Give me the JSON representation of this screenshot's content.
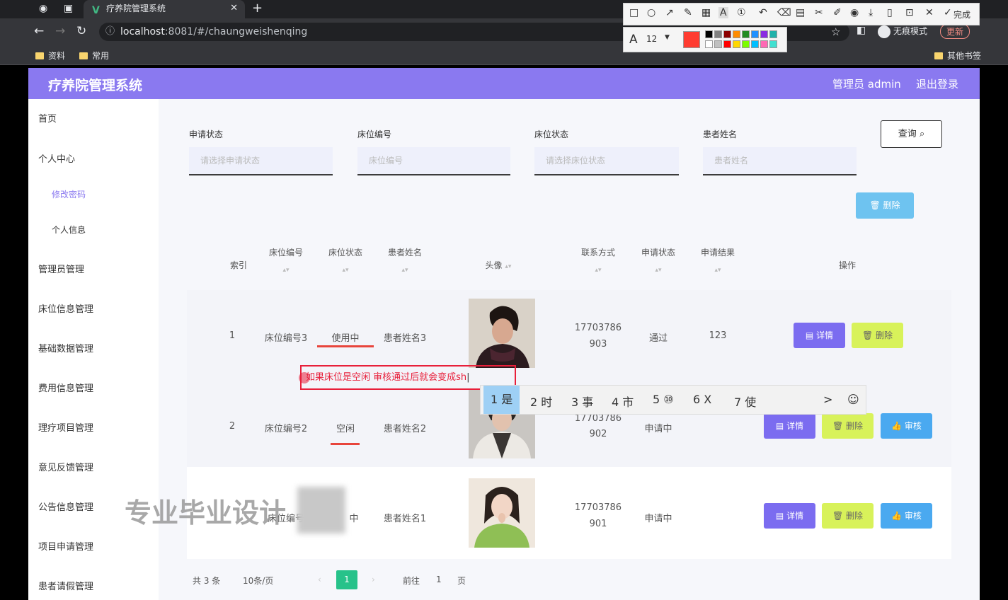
{
  "browser": {
    "tab_title": "疗养院管理系统",
    "tab_logo": "V",
    "url_host": "localhost",
    "url_rest": ":8081/#/chaungweishenqing",
    "bookmarks": [
      "资料",
      "常用"
    ],
    "other_bookmarks": "其他书签",
    "incognito_label": "无痕模式",
    "update_label": "更新"
  },
  "snap_tool": {
    "done_label": "完成",
    "font_size": "12",
    "icons": [
      "rect-icon",
      "circle-icon",
      "arrow-icon",
      "pen-icon",
      "mosaic-icon",
      "text-icon",
      "number-icon",
      "undo-icon",
      "delete-icon",
      "ocr-icon",
      "scissors-icon",
      "pin-icon",
      "record-icon",
      "download-icon",
      "save-icon",
      "pin-window-icon",
      "close-icon",
      "check-icon"
    ],
    "colors": [
      "#ff3b30",
      "#000000",
      "#808080",
      "#8b0000",
      "#ff8c00",
      "#228b22",
      "#1e90ff",
      "#8a2be2",
      "#20b2aa",
      "#ffffff",
      "#c0c0c0",
      "#ff0000",
      "#ffd700",
      "#7cfc00",
      "#00bfff",
      "#ff69b4",
      "#40e0d0"
    ]
  },
  "app": {
    "title": "疗养院管理系统",
    "admin_label": "管理员 admin",
    "logout_label": "退出登录"
  },
  "sidebar": {
    "items": [
      {
        "label": "首页"
      },
      {
        "label": "个人中心"
      },
      {
        "label": "修改密码",
        "sub": true,
        "active": true
      },
      {
        "label": "个人信息",
        "sub": true
      },
      {
        "label": "管理员管理"
      },
      {
        "label": "床位信息管理"
      },
      {
        "label": "基础数据管理"
      },
      {
        "label": "费用信息管理"
      },
      {
        "label": "理疗项目管理"
      },
      {
        "label": "意见反馈管理"
      },
      {
        "label": "公告信息管理"
      },
      {
        "label": "项目申请管理"
      },
      {
        "label": "患者请假管理"
      }
    ]
  },
  "search": {
    "fields": [
      {
        "label": "申请状态",
        "placeholder": "请选择申请状态"
      },
      {
        "label": "床位编号",
        "placeholder": "床位编号"
      },
      {
        "label": "床位状态",
        "placeholder": "请选择床位状态"
      },
      {
        "label": "患者姓名",
        "placeholder": "患者姓名"
      }
    ],
    "query_label": "查询",
    "delete_label": "删除"
  },
  "table": {
    "headers": [
      "索引",
      "床位编号",
      "床位状态",
      "患者姓名",
      "头像",
      "联系方式",
      "申请状态",
      "申请结果",
      "操作"
    ],
    "rows": [
      {
        "index": "1",
        "bed_no": "床位编号3",
        "bed_status": "使用中",
        "patient": "患者姓名3",
        "phone1": "17703786",
        "phone2": "903",
        "apply_status": "通过",
        "result": "123",
        "actions": [
          "详情",
          "删除"
        ]
      },
      {
        "index": "2",
        "bed_no": "床位编号2",
        "bed_status": "空闲",
        "patient": "患者姓名2",
        "phone1": "17703786",
        "phone2": "902",
        "apply_status": "申请中",
        "result": "",
        "actions": [
          "详情",
          "删除",
          "审核"
        ]
      },
      {
        "index": "",
        "bed_no": "床位编号",
        "bed_status": "中",
        "patient": "患者姓名1",
        "phone1": "17703786",
        "phone2": "901",
        "apply_status": "申请中",
        "result": "",
        "actions": [
          "详情",
          "删除",
          "审核"
        ]
      }
    ]
  },
  "annotation": {
    "text": "如果床位是空闲 审核通过后就会变成sh"
  },
  "ime": {
    "candidates": [
      "1 是",
      "2 时",
      "3 事",
      "4 市",
      "5 ⑩",
      "6 X",
      "7 使"
    ],
    "next": ">",
    "emoji": "☺"
  },
  "watermark": "专业毕业设计",
  "pager": {
    "total": "共 3 条",
    "page_size": "10条/页",
    "current": "1",
    "goto_label": "前往",
    "goto_value": "1",
    "page_unit": "页"
  }
}
